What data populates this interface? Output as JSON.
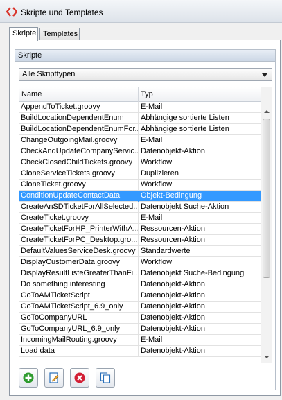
{
  "window": {
    "title": "Skripte und Templates",
    "icon": "diamond-brackets-icon",
    "accent": "#d9342b"
  },
  "tabs": [
    {
      "label": "Skripte",
      "active": true
    },
    {
      "label": "Templates",
      "active": false
    }
  ],
  "group": {
    "title": "Skripte"
  },
  "filter": {
    "selected": "Alle Skripttypen"
  },
  "table": {
    "columns": [
      "Name",
      "Typ"
    ],
    "rows": [
      {
        "name": "AppendToTicket.groovy",
        "typ": "E-Mail"
      },
      {
        "name": "BuildLocationDependentEnum",
        "typ": "Abhängige sortierte Listen"
      },
      {
        "name": "BuildLocationDependentEnumFor...",
        "typ": "Abhängige sortierte Listen"
      },
      {
        "name": "ChangeOutgoingMail.groovy",
        "typ": "E-Mail"
      },
      {
        "name": "CheckAndUpdateCompanyServic...",
        "typ": "Datenobjekt-Aktion"
      },
      {
        "name": "CheckClosedChildTickets.groovy",
        "typ": "Workflow"
      },
      {
        "name": "CloneServiceTickets.groovy",
        "typ": "Duplizieren"
      },
      {
        "name": "CloneTicket.groovy",
        "typ": "Workflow"
      },
      {
        "name": "ConditionUpdateContactData",
        "typ": "Objekt-Bedingung",
        "selected": true
      },
      {
        "name": "CreateAnSDTicketForAllSelected...",
        "typ": "Datenobjekt Suche-Aktion"
      },
      {
        "name": "CreateTicket.groovy",
        "typ": "E-Mail"
      },
      {
        "name": "CreateTicketForHP_PrinterWithA...",
        "typ": "Ressourcen-Aktion"
      },
      {
        "name": "CreateTicketForPC_Desktop.gro...",
        "typ": "Ressourcen-Aktion"
      },
      {
        "name": "DefaultValuesServiceDesk.groovy",
        "typ": "Standardwerte"
      },
      {
        "name": "DisplayCustomerData.groovy",
        "typ": "Workflow"
      },
      {
        "name": "DisplayResultListeGreaterThanFi...",
        "typ": "Datenobjekt Suche-Bedingung"
      },
      {
        "name": "Do something interesting",
        "typ": "Datenobjekt-Aktion"
      },
      {
        "name": "GoToAMTicketScript",
        "typ": "Datenobjekt-Aktion"
      },
      {
        "name": "GoToAMTicketScript_6.9_only",
        "typ": "Datenobjekt-Aktion"
      },
      {
        "name": "GoToCompanyURL",
        "typ": "Datenobjekt-Aktion"
      },
      {
        "name": "GoToCompanyURL_6.9_only",
        "typ": "Datenobjekt-Aktion"
      },
      {
        "name": "IncomingMailRouting.groovy",
        "typ": "E-Mail"
      },
      {
        "name": "Load data",
        "typ": "Datenobjekt-Aktion"
      }
    ]
  },
  "toolbar": {
    "buttons": [
      {
        "name": "add-button",
        "icon": "plus-circle-icon",
        "color": "#2e9b2e"
      },
      {
        "name": "edit-button",
        "icon": "pencil-document-icon",
        "color": "#2a6fb8"
      },
      {
        "name": "delete-button",
        "icon": "x-circle-icon",
        "color": "#d21f35"
      },
      {
        "name": "copy-button",
        "icon": "copy-document-icon",
        "color": "#2a6fb8"
      }
    ]
  }
}
